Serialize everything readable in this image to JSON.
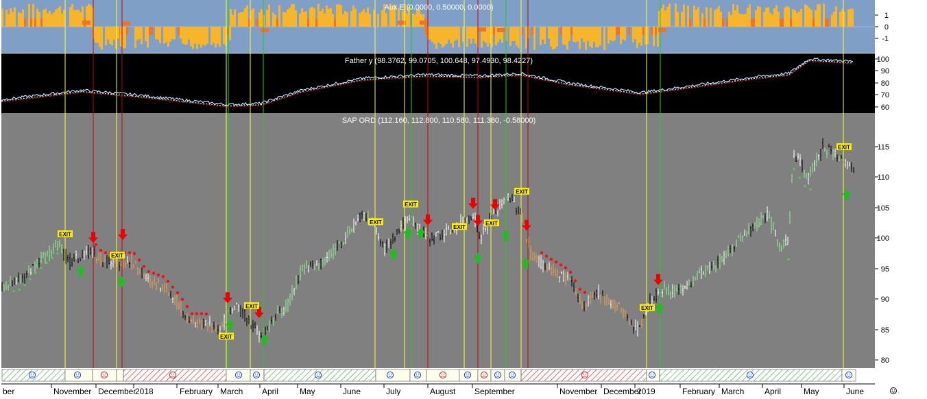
{
  "colors": {
    "aux_bg": "#7f9fc7",
    "aux_bar": "#f7b52c",
    "aux_hit": "#f07328",
    "father_bg": "#000000",
    "main_bg": "#808080",
    "up_line": "#ffff33",
    "down_line": "#cc0000",
    "green_line": "#22cc22",
    "up_arrow": "#22bb22",
    "down_arrow": "#ee0000",
    "exit_label": "#ffee00"
  },
  "panels": {
    "aux": {
      "title": "Aux E (0.0000, 0.50000, 0.0000)",
      "ticks": [
        "1",
        "0",
        "-1"
      ]
    },
    "father": {
      "title": "Father y (98.3762, 99.0705, 100.648, 97.4930, 98.4227)",
      "ticks": [
        "100",
        "90",
        "80",
        "70",
        "60"
      ]
    },
    "main": {
      "title": "SAP ORD (112.160, 112.800, 110.580, 111.380, -0.58000)",
      "ticks": [
        "115",
        "110",
        "105",
        "100",
        "95",
        "90",
        "85",
        "80"
      ]
    }
  },
  "exit_text": "EXIT",
  "months": [
    "ber",
    "November",
    "December",
    "2018",
    "February",
    "March",
    "April",
    "May",
    "June",
    "July",
    "August",
    "September",
    "November",
    "December",
    "2019",
    "February",
    "March",
    "April",
    "May",
    "June"
  ],
  "corner_icon": "smiley-icon",
  "chart_data": {
    "type": "line",
    "title": "SAP ORD (112.160, 112.800, 110.580, 111.380, -0.58000)",
    "ylim": [
      79,
      119
    ],
    "last_bar": {
      "open": 112.16,
      "high": 112.8,
      "low": 110.58,
      "close": 111.38,
      "change": -0.58
    },
    "price_anchors": [
      [
        0,
        92
      ],
      [
        30,
        93
      ],
      [
        55,
        96
      ],
      [
        85,
        99
      ],
      [
        100,
        96
      ],
      [
        120,
        97
      ],
      [
        135,
        98
      ],
      [
        150,
        96
      ],
      [
        175,
        96
      ],
      [
        195,
        96
      ],
      [
        215,
        93
      ],
      [
        240,
        92
      ],
      [
        262,
        89
      ],
      [
        280,
        86
      ],
      [
        300,
        86
      ],
      [
        320,
        85
      ],
      [
        340,
        89
      ],
      [
        360,
        87
      ],
      [
        380,
        84
      ],
      [
        400,
        87
      ],
      [
        420,
        89
      ],
      [
        440,
        95
      ],
      [
        470,
        96
      ],
      [
        505,
        100
      ],
      [
        528,
        104
      ],
      [
        545,
        102
      ],
      [
        560,
        98
      ],
      [
        585,
        102
      ],
      [
        600,
        103
      ],
      [
        625,
        100
      ],
      [
        655,
        101
      ],
      [
        690,
        104
      ],
      [
        700,
        100
      ],
      [
        720,
        104
      ],
      [
        742,
        107
      ],
      [
        760,
        104
      ],
      [
        775,
        97
      ],
      [
        800,
        95
      ],
      [
        830,
        93
      ],
      [
        850,
        89
      ],
      [
        870,
        91
      ],
      [
        900,
        89
      ],
      [
        930,
        85
      ],
      [
        950,
        90
      ],
      [
        970,
        92
      ],
      [
        990,
        91
      ],
      [
        1020,
        94
      ],
      [
        1050,
        96
      ],
      [
        1080,
        100
      ],
      [
        1100,
        102
      ],
      [
        1120,
        104
      ],
      [
        1135,
        99
      ],
      [
        1150,
        99
      ],
      [
        1157,
        114
      ],
      [
        1180,
        110
      ],
      [
        1200,
        115
      ],
      [
        1230,
        113
      ],
      [
        1245,
        111
      ]
    ],
    "father_series": {
      "name": "Father y",
      "ylim": [
        55,
        105
      ],
      "anchors": [
        [
          0,
          66
        ],
        [
          120,
          74
        ],
        [
          200,
          70
        ],
        [
          330,
          62
        ],
        [
          380,
          63
        ],
        [
          440,
          74
        ],
        [
          530,
          84
        ],
        [
          620,
          87
        ],
        [
          700,
          86
        ],
        [
          760,
          88
        ],
        [
          830,
          80
        ],
        [
          935,
          72
        ],
        [
          1000,
          77
        ],
        [
          1100,
          85
        ],
        [
          1150,
          88
        ],
        [
          1180,
          100
        ],
        [
          1245,
          98
        ]
      ]
    },
    "aux_series": {
      "name": "Aux E",
      "ylim": [
        -2,
        2
      ],
      "segments": [
        [
          0,
          135,
          1
        ],
        [
          135,
          175,
          -1
        ],
        [
          175,
          335,
          -1
        ],
        [
          335,
          385,
          1
        ],
        [
          385,
          620,
          1
        ],
        [
          620,
          760,
          -1
        ],
        [
          760,
          960,
          -1
        ],
        [
          960,
          1245,
          1
        ]
      ]
    },
    "signals": {
      "yellow_lines_x": [
        95,
        170,
        330,
        365,
        547,
        590,
        677,
        716,
        760,
        943,
        1230
      ],
      "red_lines_x": [
        136,
        178,
        624,
        697,
        770
      ],
      "green_lines_x": [
        333,
        384,
        600,
        738,
        963
      ],
      "arrows_up": [
        [
          118,
          95.5
        ],
        [
          177,
          93.8
        ],
        [
          336,
          86.6
        ],
        [
          386,
          84.2
        ],
        [
          574,
          98.3
        ],
        [
          595,
          101.7
        ],
        [
          614,
          101.7
        ],
        [
          697,
          97.6
        ],
        [
          738,
          101.3
        ],
        [
          767,
          96.8
        ],
        [
          962,
          89.4
        ],
        [
          1235,
          108
        ]
      ],
      "arrows_down": [
        [
          136,
          99.2
        ],
        [
          179,
          99.7
        ],
        [
          332,
          89.3
        ],
        [
          378,
          86.9
        ],
        [
          624,
          102.1
        ],
        [
          690,
          104.8
        ],
        [
          697,
          102
        ],
        [
          722,
          104.6
        ],
        [
          768,
          101.2
        ],
        [
          960,
          92.3
        ]
      ],
      "exit_labels": [
        [
          95,
          100.7
        ],
        [
          171,
          97.2
        ],
        [
          330,
          83.9
        ],
        [
          367,
          88.9
        ],
        [
          548,
          102.7
        ],
        [
          599,
          105.6
        ],
        [
          670,
          101.9
        ],
        [
          717,
          102.5
        ],
        [
          761,
          107.7
        ],
        [
          944,
          88.6
        ],
        [
          1231,
          115
        ]
      ]
    },
    "bottom_strip": [
      {
        "from": 0,
        "to": 95,
        "kind": "up"
      },
      {
        "from": 95,
        "to": 135,
        "kind": "flat"
      },
      {
        "from": 135,
        "to": 170,
        "kind": "flat"
      },
      {
        "from": 170,
        "to": 180,
        "kind": "flat"
      },
      {
        "from": 180,
        "to": 330,
        "kind": "down"
      },
      {
        "from": 330,
        "to": 365,
        "kind": "flat"
      },
      {
        "from": 365,
        "to": 385,
        "kind": "flat"
      },
      {
        "from": 385,
        "to": 548,
        "kind": "up"
      },
      {
        "from": 548,
        "to": 598,
        "kind": "flat"
      },
      {
        "from": 598,
        "to": 622,
        "kind": "flat"
      },
      {
        "from": 622,
        "to": 670,
        "kind": "flat"
      },
      {
        "from": 670,
        "to": 697,
        "kind": "flat"
      },
      {
        "from": 697,
        "to": 716,
        "kind": "flat"
      },
      {
        "from": 716,
        "to": 736,
        "kind": "flat"
      },
      {
        "from": 736,
        "to": 760,
        "kind": "flat"
      },
      {
        "from": 760,
        "to": 943,
        "kind": "down"
      },
      {
        "from": 943,
        "to": 962,
        "kind": "flat"
      },
      {
        "from": 962,
        "to": 1228,
        "kind": "up"
      },
      {
        "from": 1228,
        "to": 1248,
        "kind": "flat"
      }
    ],
    "strip_faces": [
      [
        47,
        "happy"
      ],
      [
        113,
        "happy"
      ],
      [
        152,
        "sad"
      ],
      [
        252,
        "sad"
      ],
      [
        348,
        "happy"
      ],
      [
        374,
        "happy"
      ],
      [
        464,
        "happy"
      ],
      [
        569,
        "happy"
      ],
      [
        609,
        "happy"
      ],
      [
        646,
        "sad"
      ],
      [
        682,
        "happy"
      ],
      [
        706,
        "sad"
      ],
      [
        726,
        "happy"
      ],
      [
        747,
        "happy"
      ],
      [
        853,
        "sad"
      ],
      [
        951,
        "happy"
      ],
      [
        1094,
        "happy"
      ],
      [
        1238,
        "happy"
      ]
    ]
  }
}
